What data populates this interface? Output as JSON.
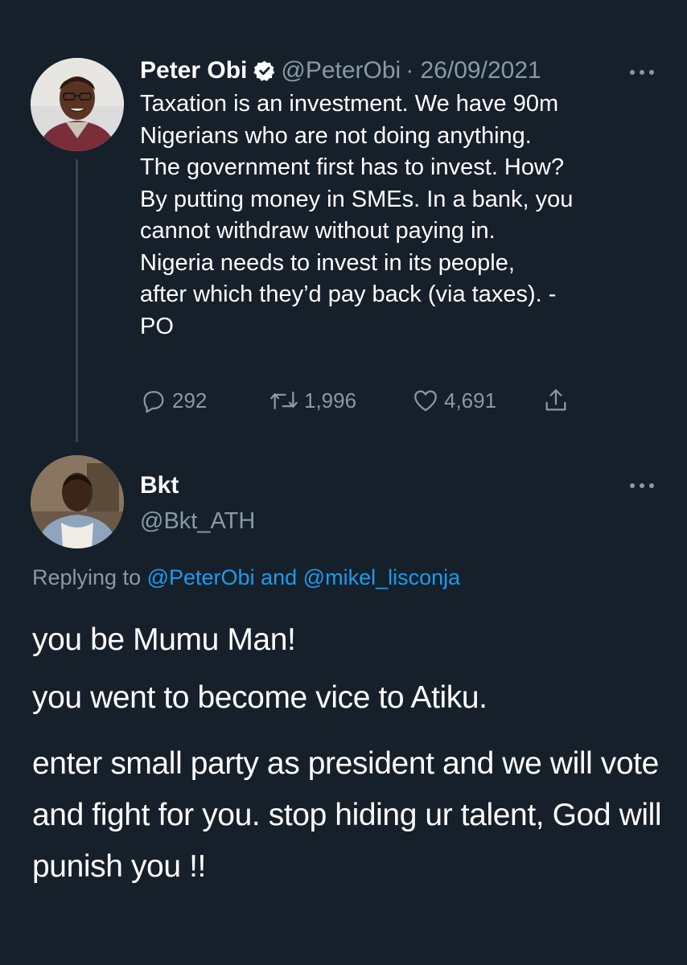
{
  "tweet1": {
    "name": "Peter Obi",
    "handle": "@PeterObi",
    "date": "· 26/09/2021",
    "body": "Taxation is an investment. We have 90m\nNigerians who are not doing anything.\nThe government first has to invest. How?\nBy putting money in SMEs. In a bank, you\ncannot withdraw without paying in.\nNigeria needs to invest in its people,\nafter which they’d pay back (via taxes). -\nPO",
    "replies": "292",
    "retweets": "1,996",
    "likes": "4,691",
    "icons": {
      "verified": "verified-badge-icon",
      "more": "more-dots-icon",
      "reply": "reply-icon",
      "retweet": "retweet-icon",
      "like": "heart-icon",
      "share": "share-icon"
    }
  },
  "tweet2": {
    "name": "Bkt",
    "handle": "@Bkt_ATH",
    "replying_prefix": "Replying to",
    "replying_user1": "@PeterObi",
    "replying_and": "and",
    "replying_user2": "@mikel_lisconja",
    "paragraphs": [
      "you be Mumu Man!",
      "you went to become vice to Atiku.",
      "enter small party as president and we will vote and fight for you.  stop hiding ur talent, God will punish you !!"
    ]
  },
  "colors": {
    "background": "#15202b",
    "text": "#ffffff",
    "muted": "#8899a6",
    "link": "#1d9bf0",
    "thread_line": "#38444d"
  }
}
